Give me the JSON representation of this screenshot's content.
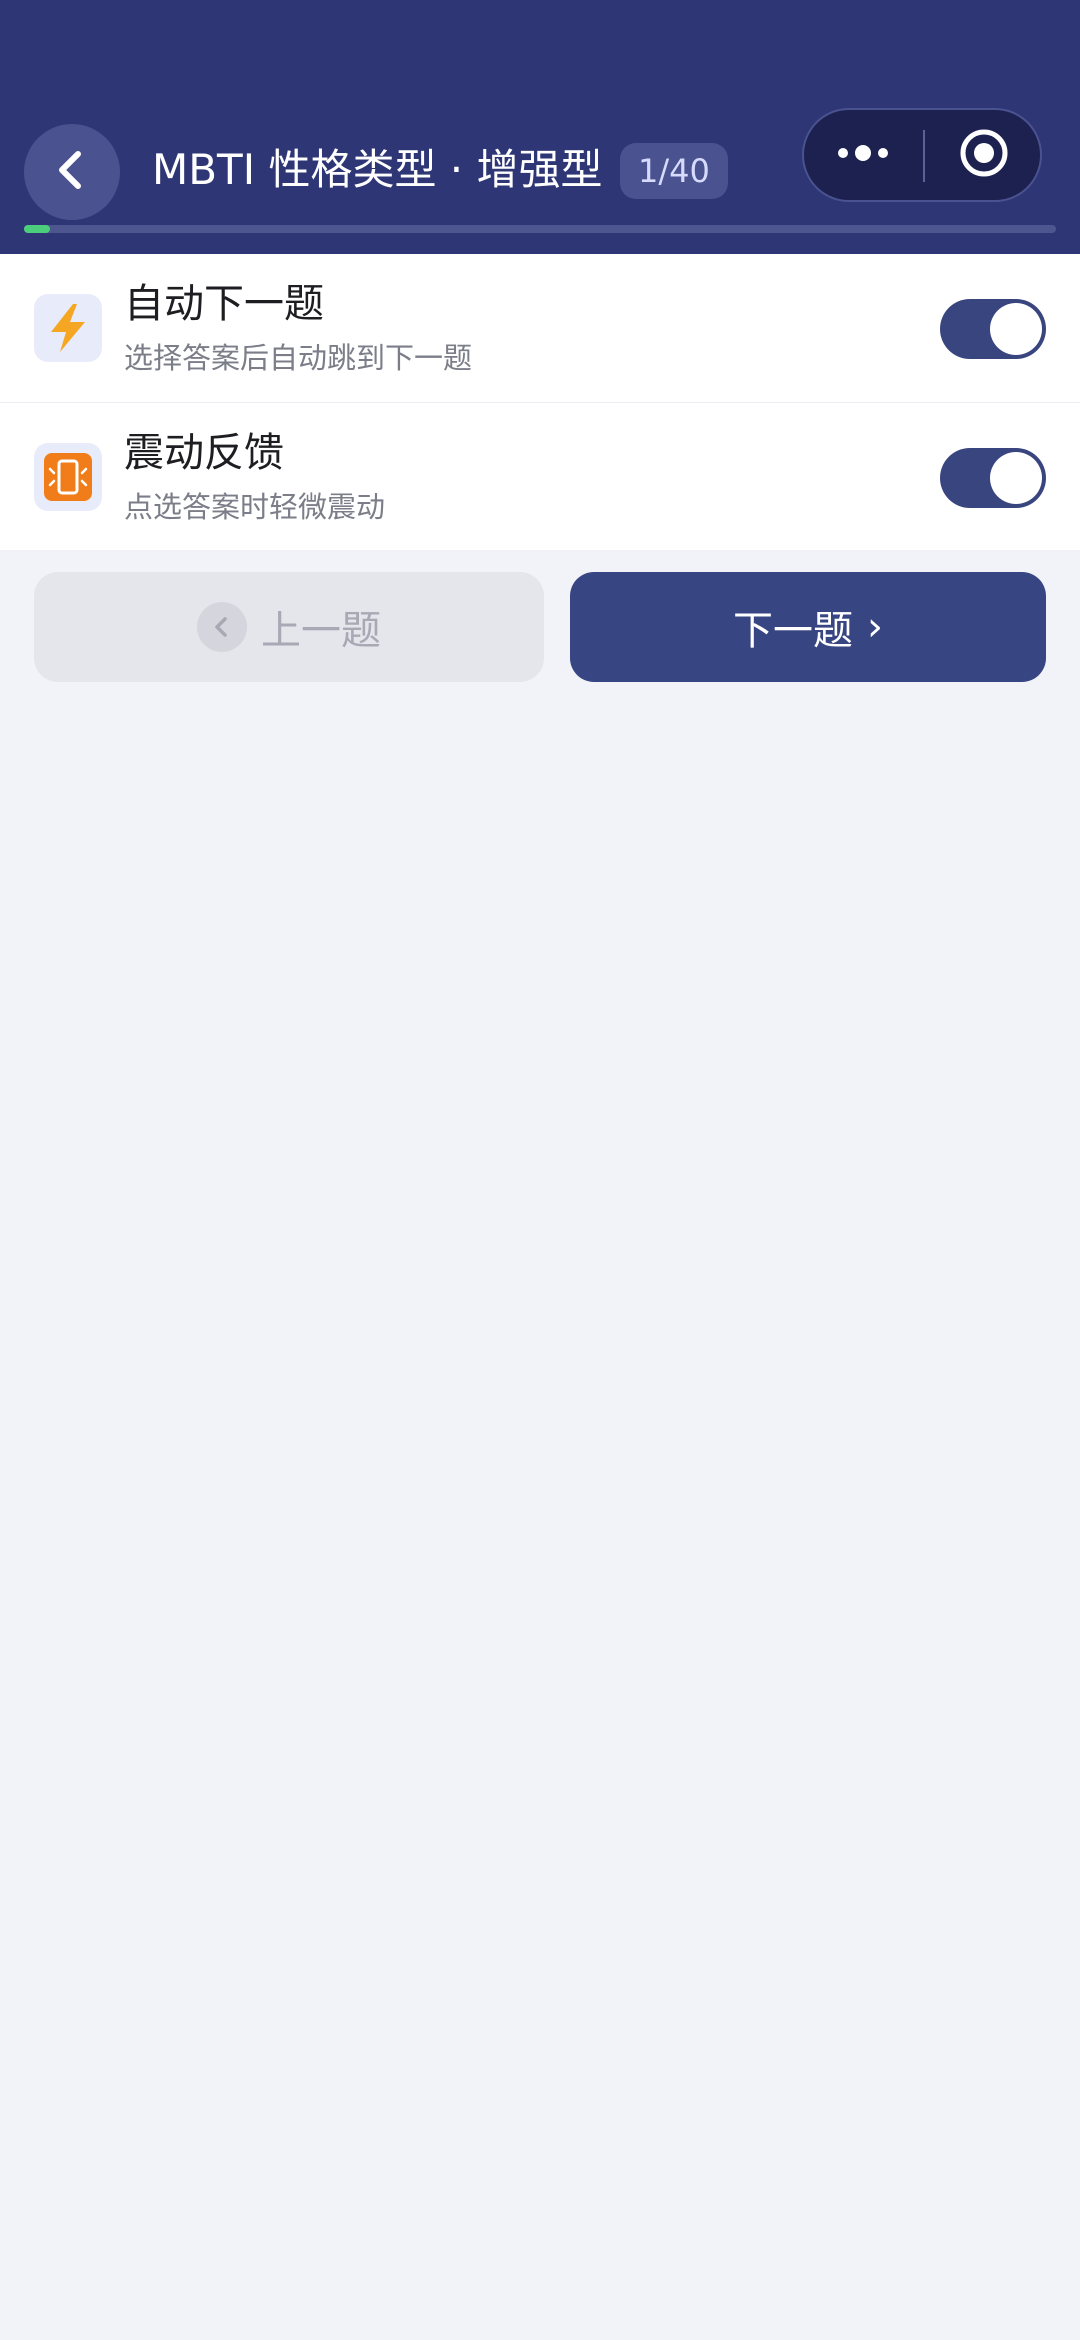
{
  "header": {
    "title": "MBTI 性格类型 · 增强型",
    "counter": "1/40",
    "progress_fraction": 0.025,
    "back_icon": "chevron-left-icon",
    "more_icon": "more-dots-icon",
    "close_icon": "target-circle-icon"
  },
  "settings": [
    {
      "title": "自动下一题",
      "subtitle": "选择答案后自动跳到下一题",
      "icon": "lightning-icon",
      "enabled": true
    },
    {
      "title": "震动反馈",
      "subtitle": "点选答案时轻微震动",
      "icon": "phone-vibrate-icon",
      "enabled": true
    }
  ],
  "nav": {
    "prev_label": "上一题",
    "next_label": "下一题",
    "next_chevron": "›"
  },
  "colors": {
    "header_bg": "#2e3675",
    "accent": "#374583",
    "progress": "#4ccf7c",
    "page_bg": "#f2f3f8"
  }
}
